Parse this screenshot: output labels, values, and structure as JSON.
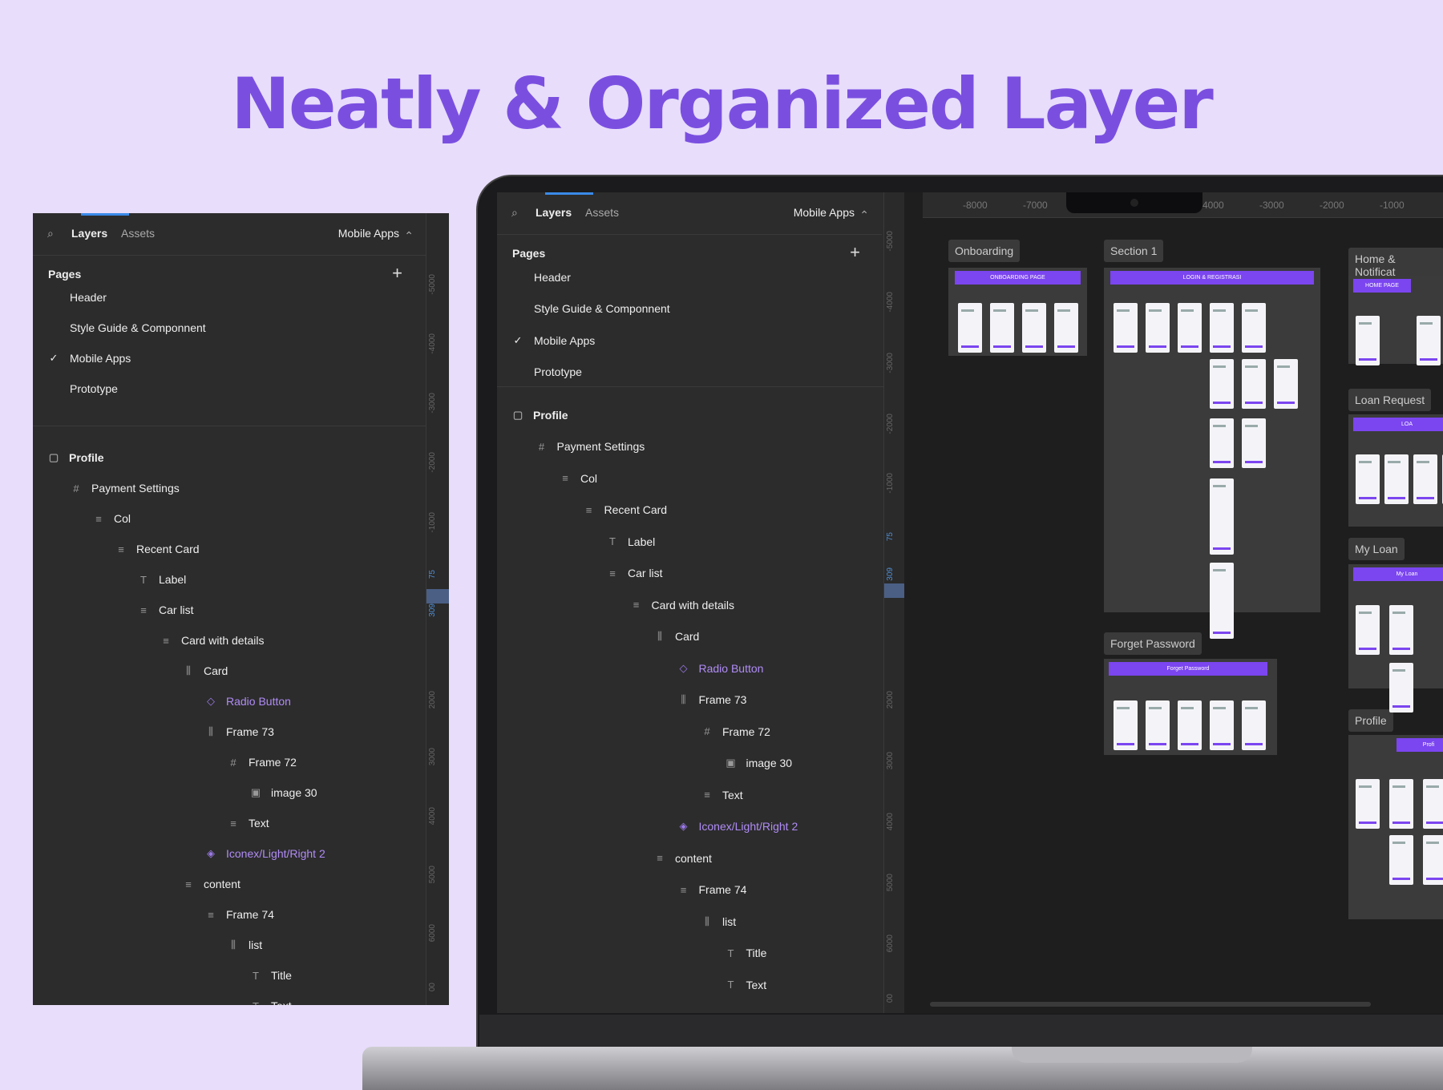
{
  "headline": "Neatly & Organized Layer",
  "panel": {
    "tab_layers": "Layers",
    "tab_assets": "Assets",
    "page_selector": "Mobile Apps",
    "pages_heading": "Pages",
    "pages": [
      {
        "label": "Header",
        "checked": false
      },
      {
        "label": "Style Guide & Componnent",
        "checked": false
      },
      {
        "label": "Mobile Apps",
        "checked": true
      },
      {
        "label": "Prototype",
        "checked": false
      }
    ],
    "layers": [
      {
        "label": "Profile",
        "icon": "frame-icon",
        "depth": 0
      },
      {
        "label": "Payment Settings",
        "icon": "hash-icon",
        "depth": 1
      },
      {
        "label": "Col",
        "icon": "auto-layout-icon",
        "depth": 2
      },
      {
        "label": "Recent Card",
        "icon": "auto-layout-icon",
        "depth": 3
      },
      {
        "label": "Label",
        "icon": "text-icon",
        "depth": 4
      },
      {
        "label": "Car list",
        "icon": "auto-layout-icon",
        "depth": 4
      },
      {
        "label": "Card with details",
        "icon": "auto-layout-icon",
        "depth": 5
      },
      {
        "label": "Card",
        "icon": "columns-icon",
        "depth": 6
      },
      {
        "label": "Radio Button",
        "icon": "component-icon",
        "depth": 7
      },
      {
        "label": "Frame 73",
        "icon": "columns-icon",
        "depth": 7
      },
      {
        "label": "Frame 72",
        "icon": "hash-icon",
        "depth": 8
      },
      {
        "label": "image 30",
        "icon": "image-icon",
        "depth": 9
      },
      {
        "label": "Text",
        "icon": "auto-layout-icon",
        "depth": 8
      },
      {
        "label": "Iconex/Light/Right 2",
        "icon": "instance-icon",
        "depth": 7
      },
      {
        "label": "content",
        "icon": "auto-layout-icon",
        "depth": 6
      },
      {
        "label": "Frame 74",
        "icon": "auto-layout-icon",
        "depth": 7
      },
      {
        "label": "list",
        "icon": "columns-icon",
        "depth": 8
      },
      {
        "label": "Title",
        "icon": "text-icon",
        "depth": 9
      },
      {
        "label": "Text",
        "icon": "text-icon",
        "depth": 9
      }
    ]
  },
  "ruler_left": [
    "-5000",
    "-4000",
    "-3000",
    "-2000",
    "-1000",
    "75",
    "309",
    "2000",
    "3000",
    "4000",
    "5000",
    "6000",
    "00"
  ],
  "ruler_top": [
    "-8000",
    "-7000",
    "-4000",
    "-3000",
    "-2000",
    "-1000"
  ],
  "canvas_sections": [
    {
      "label": "Onboarding",
      "bar": "ONBOARDING PAGE"
    },
    {
      "label": "Section 1",
      "bar": "LOGIN & REGISTRASI"
    },
    {
      "label": "Forget Password",
      "bar": "Forget Password"
    },
    {
      "label": "Home & Notificat",
      "bar": "HOME PAGE"
    },
    {
      "label": "Loan Request",
      "bar": "LOA"
    },
    {
      "label": "My Loan",
      "bar": "My Loan"
    },
    {
      "label": "Profile",
      "bar": "Profi"
    }
  ],
  "colors": {
    "accent": "#7a4fe0",
    "component": "#b08cf6",
    "panel_bg": "#2c2c2c",
    "page_bg": "#e8ddfb"
  }
}
